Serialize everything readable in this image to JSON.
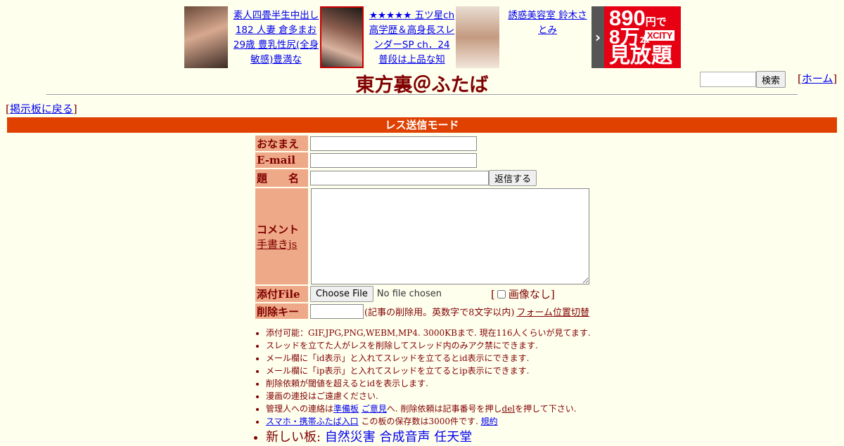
{
  "ads": [
    {
      "thumb_icon": "ad-thumbnail-photo",
      "text": "素人四畳半生中出し182 人妻 倉多まお 29歳 豊乳性尻(全身敏感)豊満な"
    },
    {
      "thumb_icon": "ad-thumbnail-photo",
      "text": "★★★★★ 五ツ星ch 高学歴＆高身長スレンダーSP ch．24 普段は上品な知"
    },
    {
      "thumb_icon": "ad-thumbnail-photo",
      "text": "誘惑美容室 鈴木さとみ"
    }
  ],
  "promo": {
    "price": "890",
    "price_unit": "円で",
    "count": "8万",
    "count_unit": "本",
    "brand": "XCITY",
    "tagline": "見放題",
    "arrow": "›"
  },
  "header": {
    "title": "東方裏＠ふたば",
    "search_button": "検索",
    "home_link": "ホーム",
    "back_link": "掲示板に戻る"
  },
  "mode_bar": "レス送信モード",
  "form": {
    "name_label": "おなまえ",
    "email_label": "E-mail",
    "subject_label": "題　　名",
    "submit_button": "返信する",
    "comment_label": "コメント",
    "handwrite_link": "手書きjs",
    "file_label": "添付File",
    "choose_file": "Choose File",
    "no_file": "No file chosen",
    "no_image": "画像なし",
    "delkey_label": "削除キー",
    "delkey_note": "(記事の削除用。英数字で8文字以内)",
    "form_position_link": "フォーム位置切替"
  },
  "notes": {
    "n1": "添付可能：GIF,JPG,PNG,WEBM,MP4. 3000KBまで. 現在116人くらいが見てます.",
    "n2": "スレッドを立てた人がレスを削除してスレッド内のみアク禁にできます.",
    "n3": "メール欄に「id表示」と入れてスレッドを立てるとid表示にできます.",
    "n4": "メール欄に「ip表示」と入れてスレッドを立てるとip表示にできます.",
    "n5": "削除依頼が閾値を超えるとidを表示します.",
    "n6": "漫画の連投はご遠慮ください.",
    "n7_pre": "管理人への連絡は",
    "n7_link1": "準備板",
    "n7_link2": "ご意見",
    "n7_mid": "へ. 削除依頼は記事番号を押し",
    "n7_del": "del",
    "n7_post": "を押して下さい.",
    "n8_link": "スマホ・携帯ふたば入口",
    "n8_mid": "この板の保存数は3000件です.",
    "n8_rules": "規約",
    "n9_label": "新しい板:",
    "n9_links": [
      "自然災害",
      "合成音声",
      "任天堂"
    ]
  }
}
